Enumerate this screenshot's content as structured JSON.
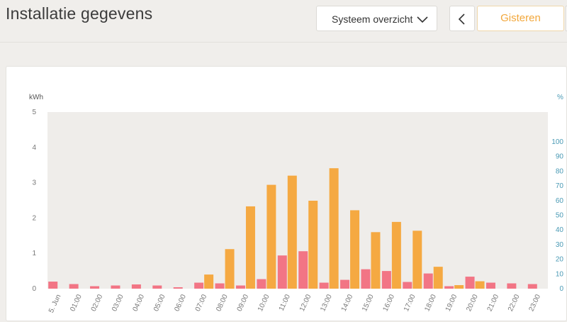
{
  "header": {
    "title": "Installatie gegevens",
    "view_select": {
      "value": "Systeem overzicht",
      "icon": "chevron-down-icon"
    },
    "prev_icon": "chevron-left-icon",
    "day_button": "Gisteren"
  },
  "colors": {
    "page_bg": "#f0eeeb",
    "plot_bg": "#efedea",
    "left_axis_text": "#777777",
    "right_axis_text": "#4a9ab5",
    "accent": "#f2a73b"
  },
  "chart_data": {
    "type": "bar",
    "left_axis_unit": "kWh",
    "right_axis_unit": "%",
    "left_ylim": [
      0,
      5
    ],
    "left_ticks": [
      "0",
      "1",
      "2",
      "3",
      "4",
      "5"
    ],
    "right_ylim": [
      0,
      100
    ],
    "right_ticks": [
      "0",
      "10",
      "20",
      "30",
      "40",
      "50",
      "60",
      "70",
      "80",
      "90",
      "100"
    ],
    "categories": [
      "5. Jun",
      "01:00",
      "02:00",
      "03:00",
      "04:00",
      "05:00",
      "06:00",
      "07:00",
      "08:00",
      "09:00",
      "10:00",
      "11:00",
      "12:00",
      "13:00",
      "14:00",
      "15:00",
      "16:00",
      "17:00",
      "18:00",
      "19:00",
      "20:00",
      "21:00",
      "22:00",
      "23:00"
    ],
    "series": [
      {
        "color": "#f27585",
        "values": [
          0.2,
          0.13,
          0.07,
          0.09,
          0.12,
          0.09,
          0.04,
          0.17,
          0.15,
          0.09,
          0.27,
          0.94,
          1.06,
          0.17,
          0.25,
          0.55,
          0.5,
          0.19,
          0.43,
          0.07,
          0.34,
          0.17,
          0.15,
          0.13
        ]
      },
      {
        "color": "#f5a942",
        "values": [
          0,
          0,
          0,
          0,
          0,
          0,
          0,
          0.4,
          1.12,
          2.33,
          2.94,
          3.2,
          2.49,
          3.41,
          2.22,
          1.6,
          1.89,
          1.64,
          0.62,
          0.1,
          0.21,
          0,
          0,
          0
        ]
      }
    ],
    "grid": false
  }
}
